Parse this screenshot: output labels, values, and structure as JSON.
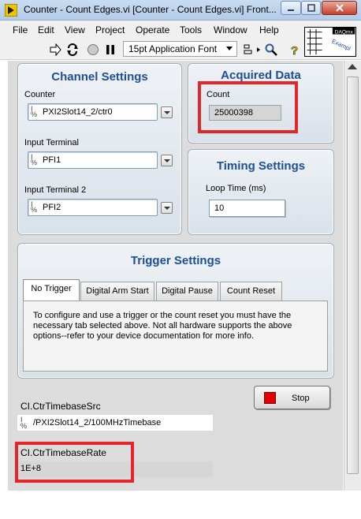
{
  "window": {
    "title": "Counter - Count Edges.vi [Counter - Count Edges.vi] Front..."
  },
  "menu": [
    "File",
    "Edit",
    "View",
    "Project",
    "Operate",
    "Tools",
    "Window",
    "Help"
  ],
  "toolbar": {
    "font_select": "15pt Application Font",
    "logo_text_1": "DAQmx",
    "logo_text_2": "Exampl"
  },
  "channel_settings": {
    "title": "Channel Settings",
    "counter_label": "Counter",
    "counter_value": "PXI2Slot14_2/ctr0",
    "input_terminal_label": "Input Terminal",
    "input_terminal_value": "PFI1",
    "input_terminal2_label": "Input Terminal 2",
    "input_terminal2_value": "PFI2"
  },
  "acquired_data": {
    "title": "Acquired Data",
    "count_label": "Count",
    "count_value": "25000398"
  },
  "timing_settings": {
    "title": "Timing Settings",
    "loop_time_label": "Loop Time (ms)",
    "loop_time_value": "10"
  },
  "trigger_settings": {
    "title": "Trigger Settings",
    "tabs": [
      "No Trigger",
      "Digital Arm Start",
      "Digital Pause",
      "Count Reset"
    ],
    "active_tab": "No Trigger",
    "description": "To configure and use a trigger or the count reset you must have the necessary tab selected above.  Not all hardware supports the above options--refer to your device documentation for more info."
  },
  "stop_button": {
    "label": "Stop"
  },
  "timebase_src": {
    "label": "CI.CtrTimebaseSrc",
    "value": "/PXI2Slot14_2/100MHzTimebase"
  },
  "timebase_rate": {
    "label": "CI.CtrTimebaseRate",
    "value": "1E+8"
  },
  "colors": {
    "cluster_title": "#1e4e96",
    "highlight_box": "#e3262a",
    "stop_led": "#e00000"
  }
}
